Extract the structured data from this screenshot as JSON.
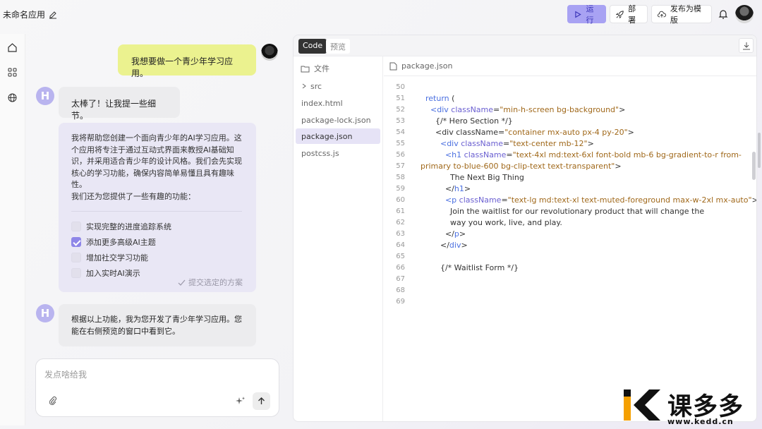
{
  "app": {
    "title": "未命名应用"
  },
  "header": {
    "run_label": "运行",
    "deploy_label": "部署",
    "publish_label": "发布为模版",
    "accent_color": "#a8a2f3"
  },
  "rail": {
    "icons": [
      "home-icon",
      "apps-icon",
      "globe-icon"
    ]
  },
  "chat": {
    "user_message": "我想要做一个青少年学习应用。",
    "bot_avatar_letter": "H",
    "bot_reply_1": "太棒了！让我提一些细节。",
    "bot_plan_paragraph": "我将帮助您创建一个面向青少年的AI学习应用。这个应用将专注于通过互动式界面来教授AI基础知识，并采用适合青少年的设计风格。我们会先实现核心的学习功能，确保内容简单易懂且具有趣味性。",
    "bot_plan_intro": "我们还为您提供了一些有趣的功能：",
    "options": [
      {
        "label": "实现完整的进度追踪系统",
        "checked": false
      },
      {
        "label": "添加更多高级AI主题",
        "checked": true
      },
      {
        "label": "增加社交学习功能",
        "checked": false
      },
      {
        "label": "加入实时AI演示",
        "checked": false
      }
    ],
    "submit_label": "提交选定的方案",
    "bot_reply_3": "根据以上功能，我为您开发了青少年学习应用。您能在右侧预览的窗口中看到它。"
  },
  "input": {
    "placeholder": "发点啥给我"
  },
  "panel": {
    "tab_code": "Code",
    "tab_preview": "预览",
    "tree_header": "文件",
    "files": [
      "src",
      "index.html",
      "package-lock.json",
      "package.json",
      "postcss.js"
    ],
    "active_file": "package.json",
    "editor_filename": "package.json",
    "code_lines": [
      {
        "n": "50",
        "html": ""
      },
      {
        "n": "51",
        "html": "  <span class='k'>return</span> ("
      },
      {
        "n": "52",
        "html": "    <span class='k'>&lt;div</span> <span class='a'>className</span>=<span class='s'>\"min-h-screen bg-background\"</span>&gt;"
      },
      {
        "n": "53",
        "html": "      {/* Hero Section */}"
      },
      {
        "n": "54",
        "html": "      &lt;div className=<span class='s'>\"container mx-auto px-4 py-20\"</span>&gt;"
      },
      {
        "n": "55",
        "html": "        <span class='k'>&lt;div</span> <span class='a'>className</span>=<span class='s'>\"text-center mb-12\"</span>&gt;"
      },
      {
        "n": "56",
        "html": "          <span class='k'>&lt;h1</span> <span class='a'>className</span>=<span class='s'>\"text-4xl md:text-6xl font-bold mb-6 bg-gradient-to-r from-</span>"
      },
      {
        "n": "57",
        "html": "<span class='s'>primary to-blue-600 bg-clip-text text-transparent\"</span>&gt;"
      },
      {
        "n": "58",
        "html": "            The Next Big Thing"
      },
      {
        "n": "59",
        "html": "          &lt;/<span class='k'>h1</span>&gt;"
      },
      {
        "n": "60",
        "html": "          <span class='k'>&lt;p</span> <span class='a'>className</span>=<span class='s'>\"text-lg md:text-xl text-muted-foreground max-w-2xl mx-auto\"</span>&gt;"
      },
      {
        "n": "61",
        "html": "            Join the waitlist for our revolutionary product that will change the"
      },
      {
        "n": "62",
        "html": "            way you work, live, and play."
      },
      {
        "n": "63",
        "html": "          &lt;/<span class='k'>p</span>&gt;"
      },
      {
        "n": "64",
        "html": "        &lt;/<span class='k'>div</span>&gt;"
      },
      {
        "n": "65",
        "html": ""
      },
      {
        "n": "66",
        "html": "        {/* Waitlist Form */}"
      },
      {
        "n": "67",
        "html": ""
      },
      {
        "n": "68",
        "html": ""
      },
      {
        "n": "69",
        "html": ""
      }
    ]
  },
  "watermark": {
    "brand": "课多多",
    "url": "www.kedd.cn"
  }
}
